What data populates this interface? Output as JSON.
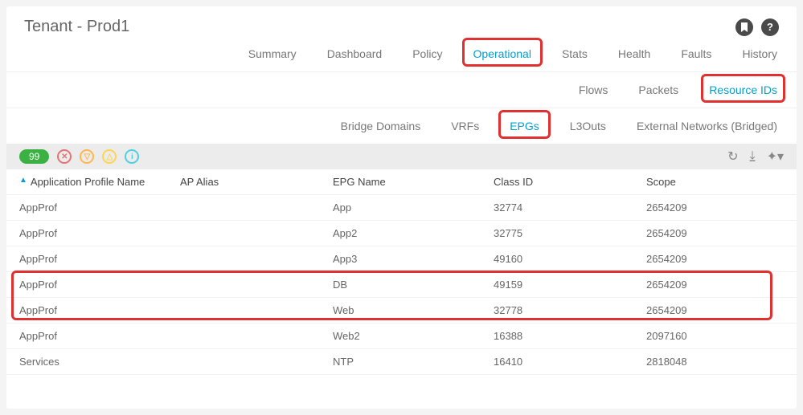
{
  "title": "Tenant - Prod1",
  "tabs": {
    "primary": [
      "Summary",
      "Dashboard",
      "Policy",
      "Operational",
      "Stats",
      "Health",
      "Faults",
      "History"
    ],
    "active_primary": "Operational",
    "secondary": [
      "Flows",
      "Packets",
      "Resource IDs"
    ],
    "active_secondary": "Resource IDs",
    "tertiary": [
      "Bridge Domains",
      "VRFs",
      "EPGs",
      "L3Outs",
      "External Networks (Bridged)"
    ],
    "active_tertiary": "EPGs"
  },
  "toolbar": {
    "count": "99"
  },
  "columns": {
    "c0": "Application Profile Name",
    "c1": "AP Alias",
    "c2": "EPG Name",
    "c3": "Class ID",
    "c4": "Scope"
  },
  "rows": [
    {
      "ap": "AppProf",
      "alias": "",
      "epg": "App",
      "cid": "32774",
      "scope": "2654209"
    },
    {
      "ap": "AppProf",
      "alias": "",
      "epg": "App2",
      "cid": "32775",
      "scope": "2654209"
    },
    {
      "ap": "AppProf",
      "alias": "",
      "epg": "App3",
      "cid": "49160",
      "scope": "2654209"
    },
    {
      "ap": "AppProf",
      "alias": "",
      "epg": "DB",
      "cid": "49159",
      "scope": "2654209"
    },
    {
      "ap": "AppProf",
      "alias": "",
      "epg": "Web",
      "cid": "32778",
      "scope": "2654209"
    },
    {
      "ap": "AppProf",
      "alias": "",
      "epg": "Web2",
      "cid": "16388",
      "scope": "2097160"
    },
    {
      "ap": "Services",
      "alias": "",
      "epg": "NTP",
      "cid": "16410",
      "scope": "2818048"
    }
  ]
}
